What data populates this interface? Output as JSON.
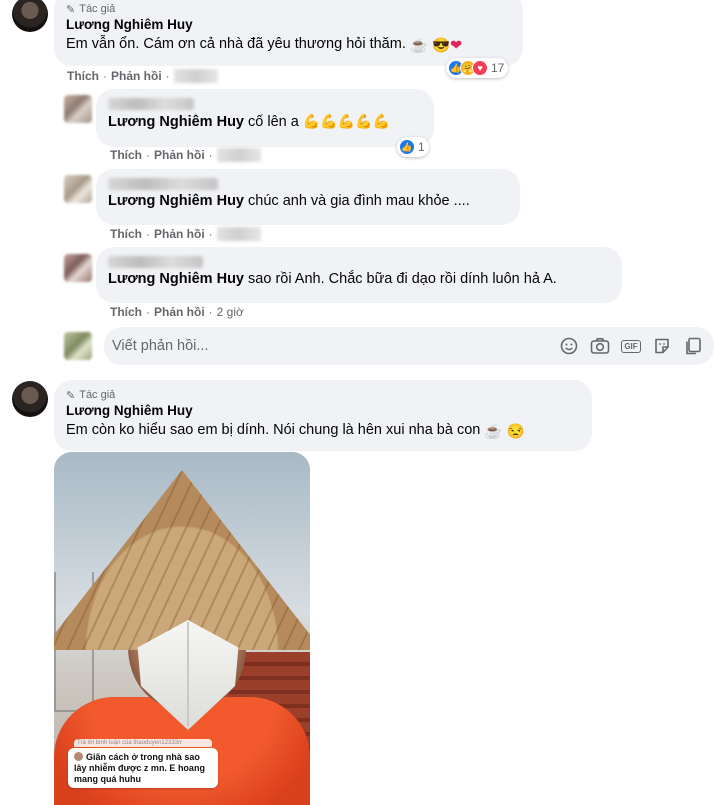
{
  "comment1": {
    "author_tag": "Tác giả",
    "author": "Lương Nghiêm Huy",
    "text": "Em vẫn ổn. Cám ơn cả nhà đã yêu thương hỏi thăm.",
    "reaction_count": "17",
    "like_label": "Thích",
    "reply_label": "Phản hồi"
  },
  "replies": [
    {
      "mention": "Lương Nghiêm Huy",
      "text": "cố lên a",
      "reaction_count": "1",
      "like_label": "Thích",
      "reply_label": "Phản hồi"
    },
    {
      "mention": "Lương Nghiêm Huy",
      "text": "chúc anh và gia đình mau khỏe ....",
      "like_label": "Thích",
      "reply_label": "Phản hồi"
    },
    {
      "mention": "Lương Nghiêm Huy",
      "text": "sao rồi Anh. Chắc bữa đi dạo rồi dính luôn hả A.",
      "like_label": "Thích",
      "reply_label": "Phản hồi",
      "time": "2 giờ"
    }
  ],
  "reply_box": {
    "placeholder": "Viết phản hồi...",
    "icons": [
      "emoji-icon",
      "camera-icon",
      "gif-icon",
      "sticker-icon",
      "file-icon"
    ]
  },
  "comment2": {
    "author_tag": "Tác giả",
    "author": "Lương Nghiêm Huy",
    "text": "Em còn ko hiểu sao em bị dính. Nói chung là hên xui nha bà con"
  },
  "video_caption": {
    "header": "Trả lời bình luận của thaoduyen12333rr",
    "body": "Giãn cách ở trong nhà sao lây nhiễm được z mn. E hoang mang quá huhu"
  },
  "colors": {
    "bubble": "#f0f2f5",
    "meta": "#65676b",
    "like_blue": "#1877f2",
    "love_red": "#f33e58"
  }
}
